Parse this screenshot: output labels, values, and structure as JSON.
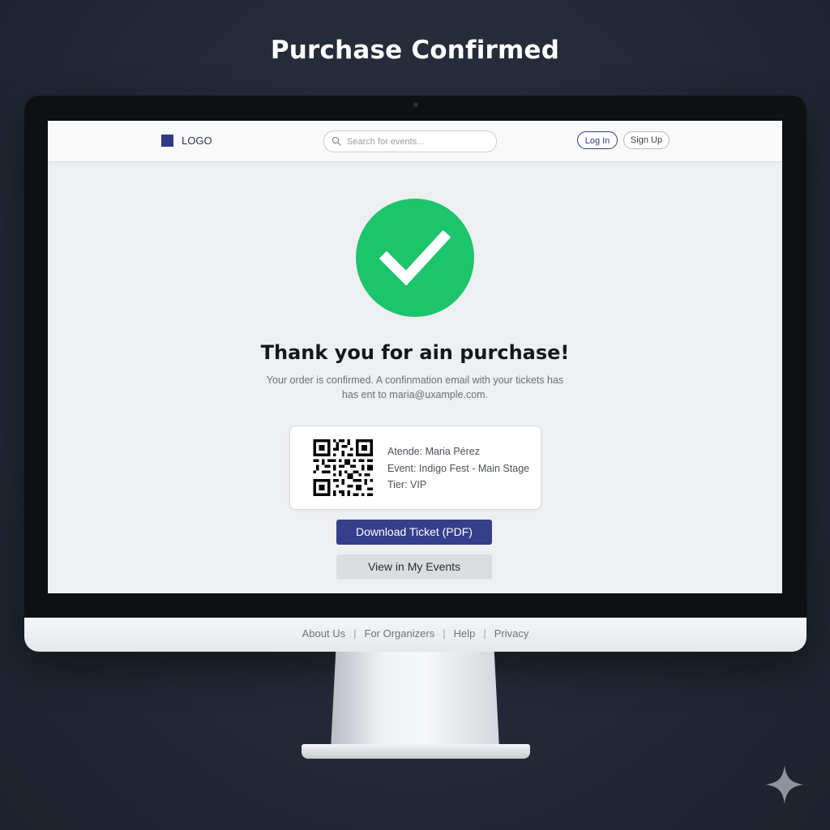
{
  "page_heading": "Purchase Confirmed",
  "header": {
    "logo_text": "LOGO",
    "search_placeholder": "Search for events...",
    "login_label": "Log In",
    "signup_label": "Sign Up"
  },
  "confirmation": {
    "title": "Thank you for ain purchase!",
    "message": "Your order is confirmed. A confinmation email with your tickets has has ent to maria@uxample.com."
  },
  "ticket": {
    "attendee": "Atende: Maria Pérez",
    "event": "Event: Indigo Fest - Main Stage",
    "tier": "Tier: VIP"
  },
  "actions": {
    "download_label": "Download Ticket (PDF)",
    "my_events_label": "View in My Events"
  },
  "footer": {
    "links": [
      "About Us",
      "For Organizers",
      "Help",
      "Privacy"
    ]
  },
  "colors": {
    "brand": "#34408c",
    "success": "#1cc46b",
    "background": "#232936"
  },
  "icons": [
    "search-icon",
    "check-icon",
    "qr-code-icon",
    "sparkle-icon"
  ]
}
